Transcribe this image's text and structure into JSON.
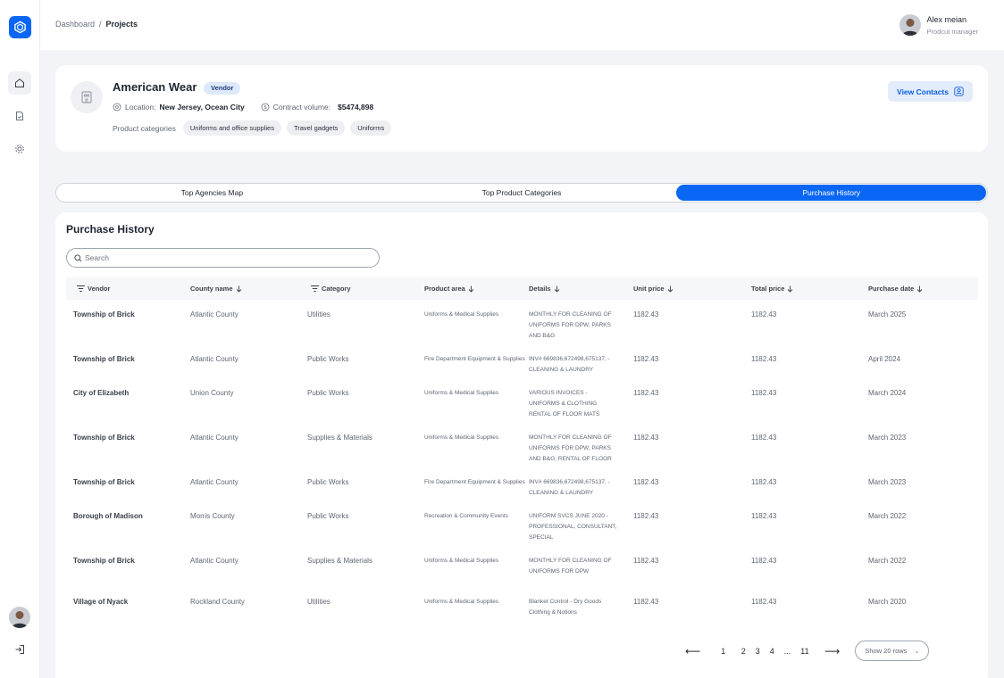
{
  "breadcrumb": {
    "parent": "Dashboard",
    "separator": "/",
    "current": "Projects"
  },
  "user": {
    "name": "Alex meian",
    "role": "Prodcut manager"
  },
  "sidebar": {
    "items": [
      "home-icon",
      "document-icon",
      "gear-icon"
    ],
    "bottom": [
      "avatar",
      "logout-icon"
    ]
  },
  "vendor": {
    "name": "American Wear",
    "badge": "Vendor",
    "location_label": "Location:",
    "location_value": "New Jersey, Ocean City",
    "contract_label": "Contract volume:",
    "contract_value": "$5474,898",
    "categories_label": "Product categories",
    "categories": [
      "Uniforms and office supplies",
      "Travel gadgets",
      "Uniforms"
    ],
    "view_contacts": "View Contacts"
  },
  "tabs": [
    {
      "label": "Top Agencies Map",
      "active": false
    },
    {
      "label": "Top Product Categories",
      "active": false
    },
    {
      "label": "Purchase History",
      "active": true
    }
  ],
  "table": {
    "title": "Purchase History",
    "search_placeholder": "Search",
    "columns": [
      "Vendor",
      "County name",
      "Category",
      "Product area",
      "Details",
      "Unit price",
      "Total price",
      "Purchase date"
    ],
    "rows": [
      [
        "Township of Brick",
        "Atlantic County",
        "Utilities",
        "Uniforms & Medical Supplies",
        "MONTHLY FOR CLEANING OF UNIFORMS FOR DPW, PARKS AND B&G",
        "1182.43",
        "1182.43",
        "March 2025"
      ],
      [
        "Township of Brick",
        "Atlantic County",
        "Public Works",
        "Fire Department Equipment & Supplies",
        "INV# 669836,672498,675137, - CLEANING & LAUNDRY",
        "1182.43",
        "1182.43",
        "April 2024"
      ],
      [
        "City of Elizabeth",
        "Union County",
        "Public Works",
        "Uniforms & Medical Supplies",
        "VARIOUS INVOICES - UNIFORMS & CLOTHING RENTAL OF FLOOR MATS",
        "1182.43",
        "1182.43",
        "March 2024"
      ],
      [
        "Township of Brick",
        "Atlantic County",
        "Supplies & Materials",
        "Uniforms & Medical Supplies",
        "MONTHLY FOR CLEANING OF UNIFORMS FOR DPW, PARKS AND B&G; RENTAL OF FLOOR",
        "1182.43",
        "1182.43",
        "March 2023"
      ],
      [
        "Township of Brick",
        "Atlantic County",
        "Public Works",
        "Fire Department Equipment & Supplies",
        "INV# 669836,672498,675137, - CLEANING & LAUNDRY",
        "1182.43",
        "1182.43",
        "March 2023"
      ],
      [
        "Borough of Madison",
        "Morris County",
        "Public Works",
        "Recreation & Community Events",
        "UNIFORM SVCS JUNE 2020 - PROFESSIONAL, CONSULTANT, SPECIAL",
        "1182.43",
        "1182.43",
        "March 2022"
      ],
      [
        "Township of Brick",
        "Atlantic County",
        "Supplies & Materials",
        "Uniforms & Medical Supplies",
        "MONTHLY FOR CLEANING OF UNIFORMS FOR DPW",
        "1182.43",
        "1182.43",
        "March 2022"
      ],
      [
        "Village of Nyack",
        "Rockland County",
        "Utilities",
        "Uniforms & Medical Supplies",
        "Blanket Control - Dry Goods Clothing & Notions",
        "1182.43",
        "1182.43",
        "March 2020"
      ]
    ]
  },
  "pagination": {
    "prev": "⟵",
    "next": "⟶",
    "pages": [
      "1",
      "2",
      "3",
      "4",
      "...",
      "11"
    ],
    "rows_select": "Show 20 rows"
  },
  "colors": {
    "accent": "#0a66f5",
    "badge_bg": "#dde8fb",
    "page_bg": "#f3f4f7"
  }
}
